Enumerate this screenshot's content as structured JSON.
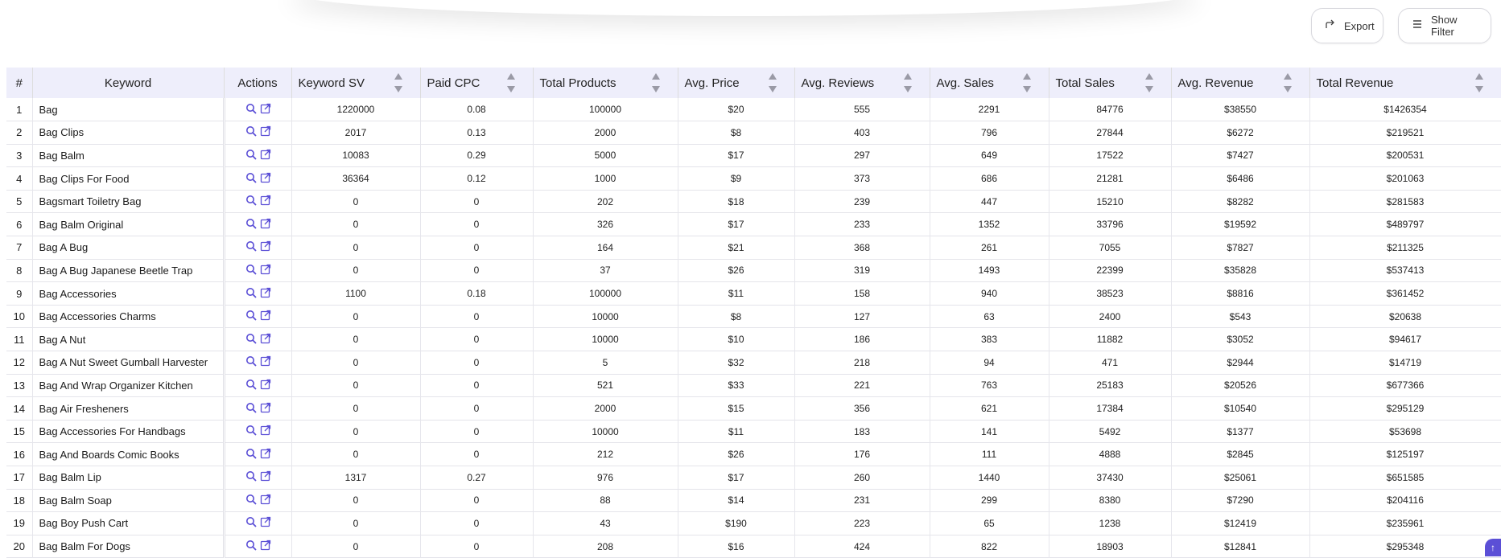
{
  "toolbar": {
    "export_label": "Export",
    "filter_label": "Show Filter"
  },
  "table": {
    "headers": {
      "index": "#",
      "keyword": "Keyword",
      "actions": "Actions",
      "keyword_sv": "Keyword SV",
      "paid_cpc": "Paid CPC",
      "total_products": "Total Products",
      "avg_price": "Avg. Price",
      "avg_reviews": "Avg. Reviews",
      "avg_sales": "Avg. Sales",
      "total_sales": "Total Sales",
      "avg_revenue": "Avg. Revenue",
      "total_revenue": "Total Revenue"
    },
    "rows": [
      {
        "index": "1",
        "keyword": "Bag",
        "sv": "1220000",
        "cpc": "0.08",
        "products": "100000",
        "price": "$20",
        "reviews": "555",
        "sales": "2291",
        "total_sales": "84776",
        "avg_revenue": "$38550",
        "total_revenue": "$1426354"
      },
      {
        "index": "2",
        "keyword": "Bag Clips",
        "sv": "2017",
        "cpc": "0.13",
        "products": "2000",
        "price": "$8",
        "reviews": "403",
        "sales": "796",
        "total_sales": "27844",
        "avg_revenue": "$6272",
        "total_revenue": "$219521"
      },
      {
        "index": "3",
        "keyword": "Bag Balm",
        "sv": "10083",
        "cpc": "0.29",
        "products": "5000",
        "price": "$17",
        "reviews": "297",
        "sales": "649",
        "total_sales": "17522",
        "avg_revenue": "$7427",
        "total_revenue": "$200531"
      },
      {
        "index": "4",
        "keyword": "Bag Clips For Food",
        "sv": "36364",
        "cpc": "0.12",
        "products": "1000",
        "price": "$9",
        "reviews": "373",
        "sales": "686",
        "total_sales": "21281",
        "avg_revenue": "$6486",
        "total_revenue": "$201063"
      },
      {
        "index": "5",
        "keyword": "Bagsmart Toiletry Bag",
        "sv": "0",
        "cpc": "0",
        "products": "202",
        "price": "$18",
        "reviews": "239",
        "sales": "447",
        "total_sales": "15210",
        "avg_revenue": "$8282",
        "total_revenue": "$281583"
      },
      {
        "index": "6",
        "keyword": "Bag Balm Original",
        "sv": "0",
        "cpc": "0",
        "products": "326",
        "price": "$17",
        "reviews": "233",
        "sales": "1352",
        "total_sales": "33796",
        "avg_revenue": "$19592",
        "total_revenue": "$489797"
      },
      {
        "index": "7",
        "keyword": "Bag A Bug",
        "sv": "0",
        "cpc": "0",
        "products": "164",
        "price": "$21",
        "reviews": "368",
        "sales": "261",
        "total_sales": "7055",
        "avg_revenue": "$7827",
        "total_revenue": "$211325"
      },
      {
        "index": "8",
        "keyword": "Bag A Bug Japanese Beetle Trap",
        "sv": "0",
        "cpc": "0",
        "products": "37",
        "price": "$26",
        "reviews": "319",
        "sales": "1493",
        "total_sales": "22399",
        "avg_revenue": "$35828",
        "total_revenue": "$537413"
      },
      {
        "index": "9",
        "keyword": "Bag Accessories",
        "sv": "1100",
        "cpc": "0.18",
        "products": "100000",
        "price": "$11",
        "reviews": "158",
        "sales": "940",
        "total_sales": "38523",
        "avg_revenue": "$8816",
        "total_revenue": "$361452"
      },
      {
        "index": "10",
        "keyword": "Bag Accessories Charms",
        "sv": "0",
        "cpc": "0",
        "products": "10000",
        "price": "$8",
        "reviews": "127",
        "sales": "63",
        "total_sales": "2400",
        "avg_revenue": "$543",
        "total_revenue": "$20638"
      },
      {
        "index": "11",
        "keyword": "Bag A Nut",
        "sv": "0",
        "cpc": "0",
        "products": "10000",
        "price": "$10",
        "reviews": "186",
        "sales": "383",
        "total_sales": "11882",
        "avg_revenue": "$3052",
        "total_revenue": "$94617"
      },
      {
        "index": "12",
        "keyword": "Bag A Nut Sweet Gumball Harvester",
        "sv": "0",
        "cpc": "0",
        "products": "5",
        "price": "$32",
        "reviews": "218",
        "sales": "94",
        "total_sales": "471",
        "avg_revenue": "$2944",
        "total_revenue": "$14719"
      },
      {
        "index": "13",
        "keyword": "Bag And Wrap Organizer Kitchen",
        "sv": "0",
        "cpc": "0",
        "products": "521",
        "price": "$33",
        "reviews": "221",
        "sales": "763",
        "total_sales": "25183",
        "avg_revenue": "$20526",
        "total_revenue": "$677366"
      },
      {
        "index": "14",
        "keyword": "Bag Air Fresheners",
        "sv": "0",
        "cpc": "0",
        "products": "2000",
        "price": "$15",
        "reviews": "356",
        "sales": "621",
        "total_sales": "17384",
        "avg_revenue": "$10540",
        "total_revenue": "$295129"
      },
      {
        "index": "15",
        "keyword": "Bag Accessories For Handbags",
        "sv": "0",
        "cpc": "0",
        "products": "10000",
        "price": "$11",
        "reviews": "183",
        "sales": "141",
        "total_sales": "5492",
        "avg_revenue": "$1377",
        "total_revenue": "$53698"
      },
      {
        "index": "16",
        "keyword": "Bag And Boards Comic Books",
        "sv": "0",
        "cpc": "0",
        "products": "212",
        "price": "$26",
        "reviews": "176",
        "sales": "111",
        "total_sales": "4888",
        "avg_revenue": "$2845",
        "total_revenue": "$125197"
      },
      {
        "index": "17",
        "keyword": "Bag Balm Lip",
        "sv": "1317",
        "cpc": "0.27",
        "products": "976",
        "price": "$17",
        "reviews": "260",
        "sales": "1440",
        "total_sales": "37430",
        "avg_revenue": "$25061",
        "total_revenue": "$651585"
      },
      {
        "index": "18",
        "keyword": "Bag Balm Soap",
        "sv": "0",
        "cpc": "0",
        "products": "88",
        "price": "$14",
        "reviews": "231",
        "sales": "299",
        "total_sales": "8380",
        "avg_revenue": "$7290",
        "total_revenue": "$204116"
      },
      {
        "index": "19",
        "keyword": "Bag Boy Push Cart",
        "sv": "0",
        "cpc": "0",
        "products": "43",
        "price": "$190",
        "reviews": "223",
        "sales": "65",
        "total_sales": "1238",
        "avg_revenue": "$12419",
        "total_revenue": "$235961"
      },
      {
        "index": "20",
        "keyword": "Bag Balm For Dogs",
        "sv": "0",
        "cpc": "0",
        "products": "208",
        "price": "$16",
        "reviews": "424",
        "sales": "822",
        "total_sales": "18903",
        "avg_revenue": "$12841",
        "total_revenue": "$295348"
      }
    ]
  },
  "colors": {
    "header_bg": "#eeeefb",
    "accent": "#5b4fd6"
  }
}
